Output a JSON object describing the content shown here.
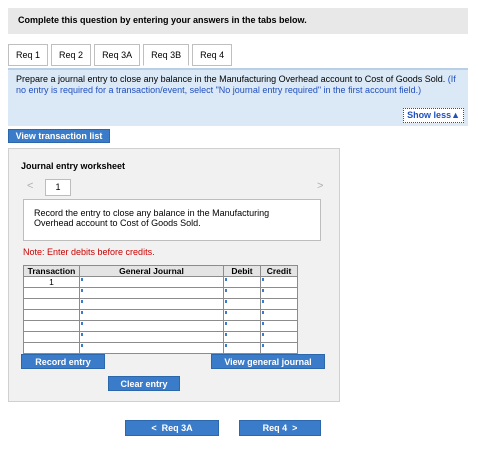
{
  "banner": {
    "text": "Complete this question by entering your answers in the tabs below."
  },
  "tabs": [
    {
      "label": "Req 1"
    },
    {
      "label": "Req 2"
    },
    {
      "label": "Req 3A"
    },
    {
      "label": "Req 3B",
      "active": true
    },
    {
      "label": "Req 4"
    }
  ],
  "instructions": {
    "text": "Prepare a journal entry to close any balance in the Manufacturing Overhead account to Cost of Goods Sold.",
    "note": "(If no entry is required for a transaction/event, select \"No journal entry required\" in the first account field.)",
    "show_less_label": "Show less",
    "show_less_icon": "triangle-up-icon"
  },
  "buttons": {
    "view_transaction_list": "View transaction list",
    "record_entry": "Record entry",
    "view_general_journal": "View general journal",
    "clear_entry": "Clear entry",
    "prev_tab": "Req 3A",
    "next_tab": "Req 4"
  },
  "worksheet": {
    "title": "Journal entry worksheet",
    "page": "1",
    "entry_description": "Record the entry to close any balance in the Manufacturing Overhead account to Cost of Goods Sold.",
    "note": "Note: Enter debits before credits."
  },
  "journal_table": {
    "headers": {
      "transaction": "Transaction",
      "general_journal": "General Journal",
      "debit": "Debit",
      "credit": "Credit"
    },
    "rows": [
      {
        "transaction": "1",
        "account": "",
        "debit": "",
        "credit": ""
      },
      {
        "transaction": "",
        "account": "",
        "debit": "",
        "credit": ""
      },
      {
        "transaction": "",
        "account": "",
        "debit": "",
        "credit": ""
      },
      {
        "transaction": "",
        "account": "",
        "debit": "",
        "credit": ""
      },
      {
        "transaction": "",
        "account": "",
        "debit": "",
        "credit": ""
      },
      {
        "transaction": "",
        "account": "",
        "debit": "",
        "credit": ""
      },
      {
        "transaction": "",
        "account": "",
        "debit": "",
        "credit": ""
      }
    ]
  },
  "colors": {
    "accent_blue": "#3a7cc9",
    "note_red": "#cc0000",
    "instruction_bg": "#dbe9f6"
  }
}
